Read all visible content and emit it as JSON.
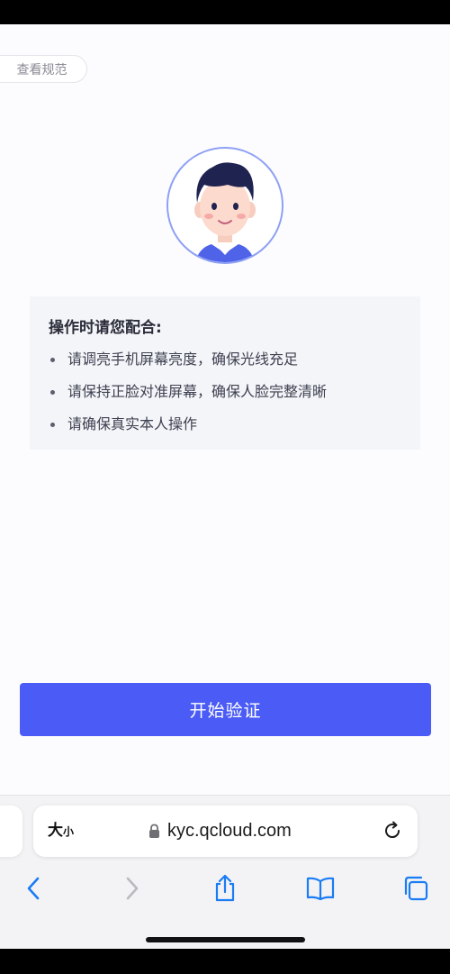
{
  "header": {
    "spec_label": "查看规范"
  },
  "tips": {
    "title": "操作时请您配合:",
    "items": [
      "请调亮手机屏幕亮度，确保光线充足",
      "请保持正脸对准屏幕，确保人脸完整清晰",
      "请确保真实本人操作"
    ]
  },
  "action": {
    "start_label": "开始验证"
  },
  "browser": {
    "text_size_big": "大",
    "text_size_small": "小",
    "url": "kyc.qcloud.com",
    "icons": [
      "lock-icon",
      "reload-icon",
      "back-icon",
      "forward-icon",
      "share-icon",
      "bookmarks-icon",
      "tabs-icon"
    ]
  },
  "colors": {
    "accent": "#4b5cf6",
    "ring": "#8ea0f4",
    "tips_bg": "#f4f5f9",
    "toolbar_blue": "#1a7cf5"
  }
}
